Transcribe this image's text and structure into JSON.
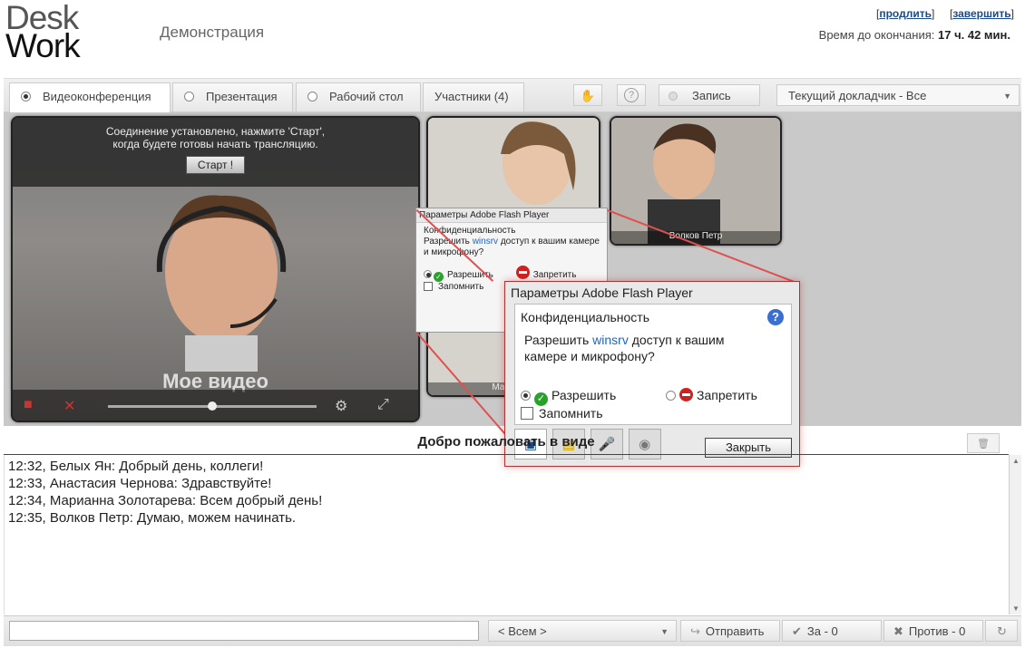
{
  "header": {
    "logo_line1": "Desk",
    "logo_line2": "Work",
    "title": "Демонстрация",
    "link_extend": "продлить",
    "link_finish": "завершить",
    "time_label": "Время до окончания:",
    "time_value": "17 ч. 42 мин."
  },
  "tabs": [
    {
      "label": "Видеоконференция",
      "active": true
    },
    {
      "label": "Презентация",
      "active": false
    },
    {
      "label": "Рабочий стол",
      "active": false
    },
    {
      "label": "Участники (4)",
      "active": false
    }
  ],
  "toolbar": {
    "hand_icon": "hand-icon",
    "help_icon": "help-icon",
    "record_label": "Запись",
    "speaker_dropdown": "Текущий докладчик - Все"
  },
  "myvideo": {
    "notice_line1": "Соединение установлено, нажмите 'Старт',",
    "notice_line2": "когда будете готовы начать трансляцию.",
    "start_label": "Старт !",
    "caption": "Мое видео",
    "volume": 0.5
  },
  "participants": [
    {
      "name": "Марианна"
    },
    {
      "name": "Волков Петр"
    }
  ],
  "flash_small": {
    "title": "Параметры Adobe Flash Player",
    "privacy": "Конфиденциальность",
    "msg_before": "Разрешить",
    "msg_host": "winsrv",
    "msg_after": "доступ к вашим камере и микрофону?",
    "allow": "Разрешить",
    "deny": "Запретить",
    "remember": "Запомнить"
  },
  "flash_big": {
    "title": "Параметры Adobe Flash Player",
    "privacy": "Конфиденциальность",
    "msg_before": "Разрешить",
    "msg_host": "winsrv",
    "msg_line1_after": "доступ к вашим",
    "msg_line2": "камере и микрофону?",
    "allow": "Разрешить",
    "deny": "Запретить",
    "remember": "Запомнить",
    "close": "Закрыть",
    "allow_selected": true
  },
  "chat": {
    "title": "Добро пожаловать в виде",
    "messages": [
      "12:32, Белых Ян: Добрый день, коллеги!",
      "12:33, Анастасия Чернова: Здравствуйте!",
      "12:34, Марианна Золотарева: Всем добрый день!",
      "12:35, Волков Петр: Думаю, можем начинать."
    ]
  },
  "bottom": {
    "input_value": "",
    "recipient": "< Всем >",
    "send": "Отправить",
    "vote_for": "За - 0",
    "vote_against": "Против - 0"
  },
  "colors": {
    "accent_red": "#e05050",
    "link_blue": "#1a4a8a",
    "allow_green": "#2aa12a",
    "deny_red": "#d21f1f"
  }
}
